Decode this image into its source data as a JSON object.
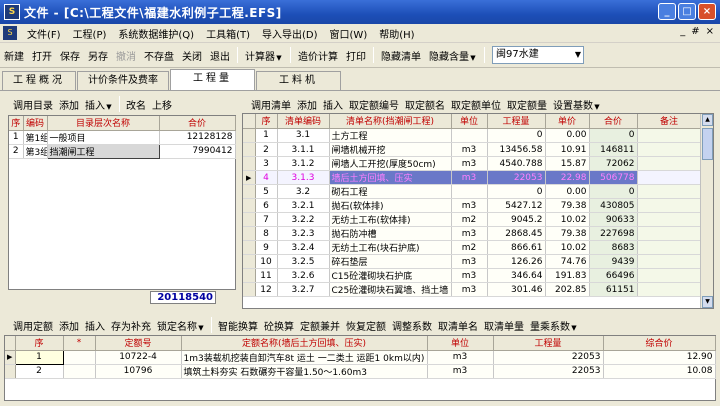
{
  "window": {
    "title": "文件 - [C:\\工程文件\\福建水利例子工程.EFS]",
    "logo": "S",
    "btn_min": "_",
    "btn_max": "□",
    "btn_close": "×"
  },
  "menu": {
    "logo": "S",
    "items": [
      "文件(F)",
      "工程(P)",
      "系统数据维护(Q)",
      "工具箱(T)",
      "导入导出(D)",
      "窗口(W)",
      "帮助(H)"
    ],
    "mdi": [
      "_",
      "#",
      "×"
    ]
  },
  "toolbar": {
    "btn_new": "新建",
    "btn_open": "打开",
    "btn_save": "保存",
    "btn_saveas": "另存",
    "btn_undo": "撤消",
    "btn_nostore": "不存盘",
    "btn_close": "关闭",
    "btn_exit": "退出",
    "btn_calc": "计算器",
    "btn_price": "造价计算",
    "btn_print": "打印",
    "btn_hidebill": "隐藏清单",
    "btn_hidecontent": "隐藏含量",
    "region_select": "闽97水建"
  },
  "tabs": [
    "工程概况",
    "计价条件及费率",
    "工程量",
    "工料机"
  ],
  "left": {
    "toolbar": [
      "调用目录",
      "添加",
      "插入",
      "改名",
      "上移"
    ],
    "headers": [
      "序",
      "编码",
      "目录层次名称",
      "合价"
    ],
    "rows": [
      {
        "seq": "1",
        "code": "第1组",
        "name": "一般项目",
        "total": "12128128"
      },
      {
        "seq": "2",
        "code": "第3组",
        "name": "挡潮闸工程",
        "total": "7990412"
      }
    ],
    "grand_total": "20118540"
  },
  "right": {
    "toolbar": [
      "调用清单",
      "添加",
      "插入",
      "取定额编号",
      "取定额名",
      "取定额单位",
      "取定额量",
      "设置基数"
    ],
    "headers": [
      "序",
      "清单编码",
      "清单名称(挡潮闸工程)",
      "单位",
      "工程量",
      "单价",
      "合价",
      "备注"
    ],
    "rows": [
      {
        "seq": "1",
        "code": "3.1",
        "name": "土方工程",
        "unit": "",
        "qty": "0",
        "price": "0.00",
        "total": "0"
      },
      {
        "seq": "2",
        "code": "3.1.1",
        "name": "闸墙机械开挖",
        "unit": "m3",
        "qty": "13456.58",
        "price": "10.91",
        "total": "146811"
      },
      {
        "seq": "3",
        "code": "3.1.2",
        "name": "闸墙人工开挖(厚度50cm)",
        "unit": "m3",
        "qty": "4540.788",
        "price": "15.87",
        "total": "72062"
      },
      {
        "seq": "4",
        "code": "3.1.3",
        "name": "墙后土方回填、压实",
        "unit": "m3",
        "qty": "22053",
        "price": "22.98",
        "total": "506778"
      },
      {
        "seq": "5",
        "code": "3.2",
        "name": "砌石工程",
        "unit": "",
        "qty": "0",
        "price": "0.00",
        "total": "0"
      },
      {
        "seq": "6",
        "code": "3.2.1",
        "name": "抛石(软体排)",
        "unit": "m3",
        "qty": "5427.12",
        "price": "79.38",
        "total": "430805"
      },
      {
        "seq": "7",
        "code": "3.2.2",
        "name": "无纺土工布(软体排)",
        "unit": "m2",
        "qty": "9045.2",
        "price": "10.02",
        "total": "90633"
      },
      {
        "seq": "8",
        "code": "3.2.3",
        "name": "抛石防冲槽",
        "unit": "m3",
        "qty": "2868.45",
        "price": "79.38",
        "total": "227698"
      },
      {
        "seq": "9",
        "code": "3.2.4",
        "name": "无纺土工布(块石护底)",
        "unit": "m2",
        "qty": "866.61",
        "price": "10.02",
        "total": "8683"
      },
      {
        "seq": "10",
        "code": "3.2.5",
        "name": "碎石垫层",
        "unit": "m3",
        "qty": "126.26",
        "price": "74.76",
        "total": "9439"
      },
      {
        "seq": "11",
        "code": "3.2.6",
        "name": "C15砼灌砌块石护底",
        "unit": "m3",
        "qty": "346.64",
        "price": "191.83",
        "total": "66496"
      },
      {
        "seq": "12",
        "code": "3.2.7",
        "name": "C25砼灌砌块石翼墙、挡土墙",
        "unit": "m3",
        "qty": "301.46",
        "price": "202.85",
        "total": "61151"
      }
    ]
  },
  "bottom": {
    "toolbar": [
      "调用定额",
      "添加",
      "插入",
      "存为补充",
      "锁定名称",
      "智能换算",
      "砼换算",
      "定额兼并",
      "恢复定额",
      "调整系数",
      "取清单名",
      "取清单量",
      "量乘系数"
    ],
    "headers": [
      "序",
      "*",
      "定额号",
      "定额名称(墙后土方回填、压实)",
      "单位",
      "工程量",
      "综合价"
    ],
    "rows": [
      {
        "seq": "1",
        "star": "",
        "code": "10722-4",
        "name": "1m3装载机挖装自卸汽车8t 运土 一二类土 运距1 0km以内)",
        "unit": "m3",
        "qty": "22053",
        "price": "12.90"
      },
      {
        "seq": "2",
        "star": "",
        "code": "10796",
        "name": "填筑土料夯实 石数碾夯干容量1.50～1.60m3",
        "unit": "m3",
        "qty": "22053",
        "price": "10.08"
      }
    ]
  }
}
